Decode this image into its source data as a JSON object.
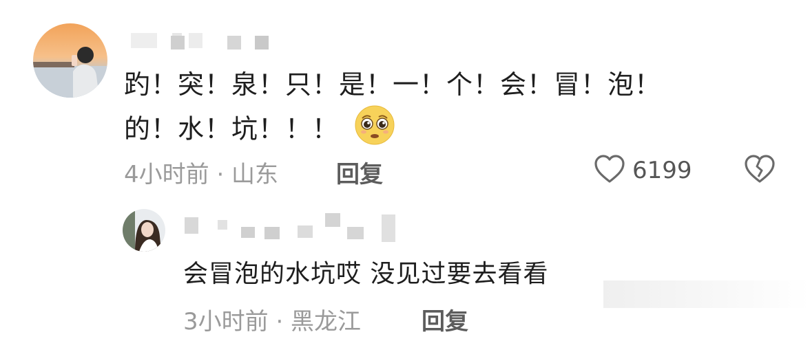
{
  "comments": {
    "main": {
      "text_line1": "趵！突！泉！只！是！一！个！会！冒！泡！",
      "text_line2": "的！水！坑！！！",
      "emoji_icon": "pleading-face-icon",
      "time_location": "4小时前 · 山东",
      "reply_label": "回复",
      "like_count": "6199"
    },
    "reply": {
      "text": "会冒泡的水坑哎 没见过要去看看",
      "time_location": "3小时前 · 黑龙江",
      "reply_label": "回复"
    }
  },
  "colors": {
    "text": "#1e1e1e",
    "meta": "#9a9a9a",
    "reply": "#5c5c5c",
    "blur": "#d9d9d9"
  }
}
